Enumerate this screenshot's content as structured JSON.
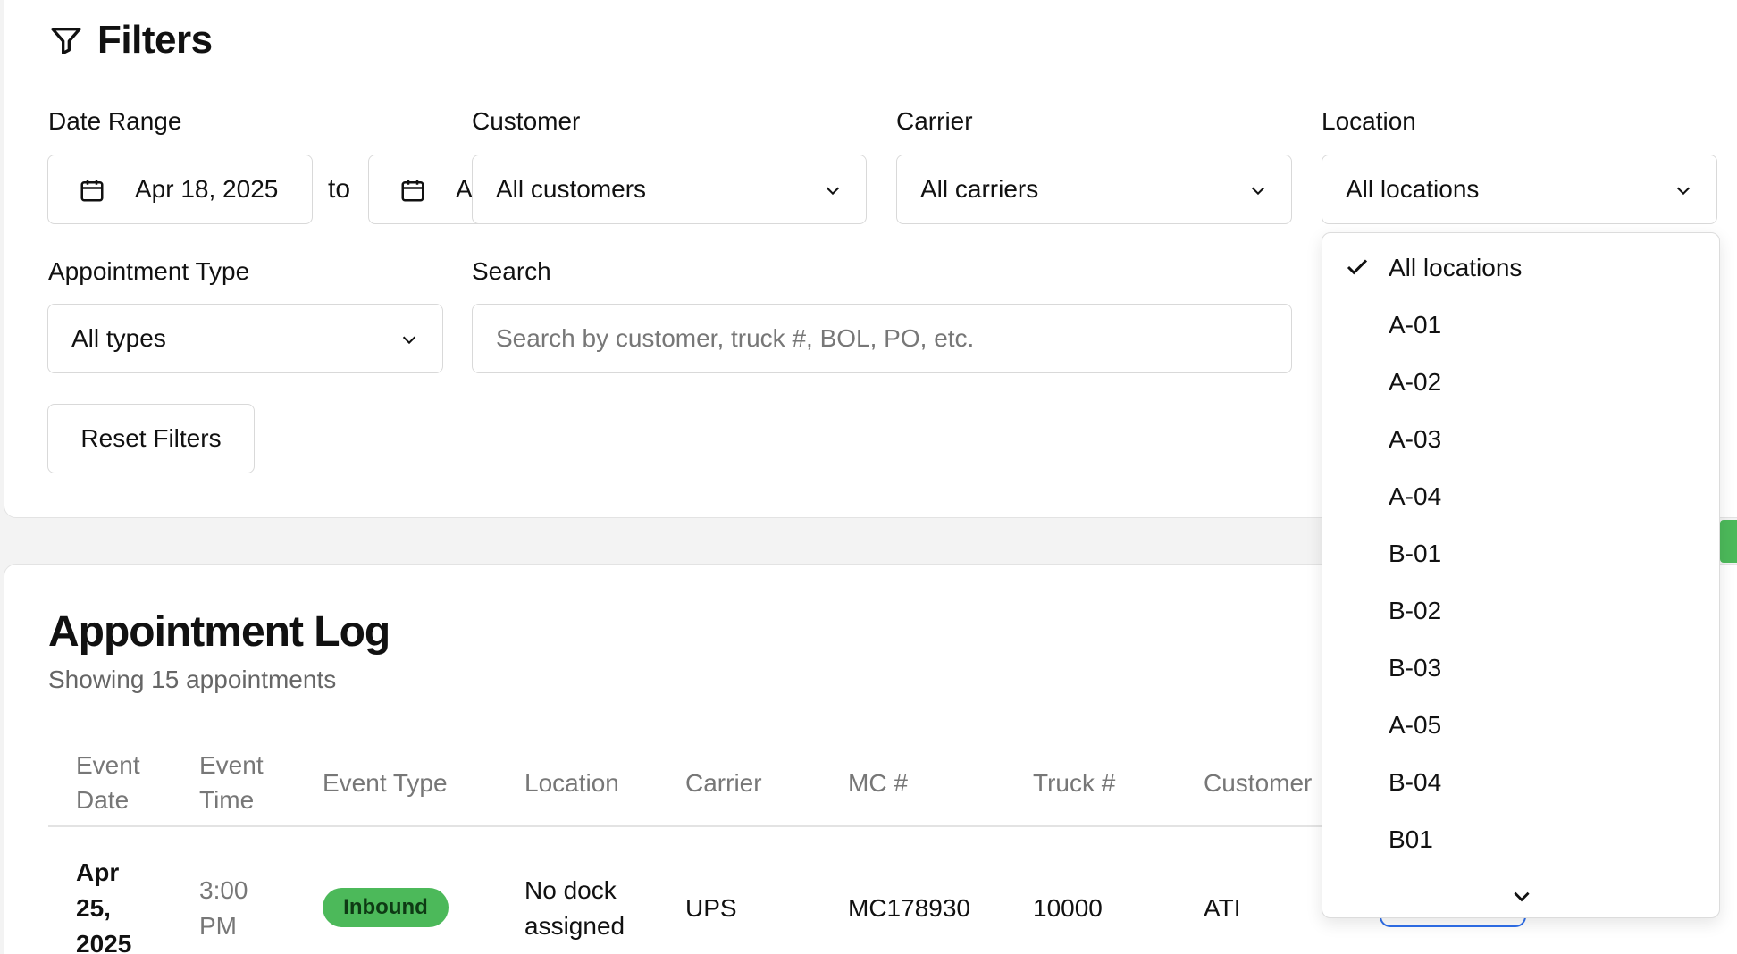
{
  "filters": {
    "title": "Filters",
    "date_range": {
      "label": "Date Range",
      "from_value": "Apr 18, 2025",
      "separator": "to",
      "to_value_visible": "A"
    },
    "customer": {
      "label": "Customer",
      "value": "All customers"
    },
    "carrier": {
      "label": "Carrier",
      "value": "All carriers"
    },
    "location": {
      "label": "Location",
      "value": "All locations"
    },
    "appointment_type": {
      "label": "Appointment Type",
      "value": "All types"
    },
    "search": {
      "label": "Search",
      "placeholder": "Search by customer, truck #, BOL, PO, etc."
    },
    "reset_label": "Reset Filters"
  },
  "location_dropdown": {
    "selected": "All locations",
    "options": [
      "All locations",
      "A-01",
      "A-02",
      "A-03",
      "A-04",
      "B-01",
      "B-02",
      "B-03",
      "A-05",
      "B-04",
      "B01"
    ]
  },
  "log": {
    "title": "Appointment Log",
    "subtitle": "Showing 15 appointments",
    "columns": [
      "Event Date",
      "Event Time",
      "Event Type",
      "Location",
      "Carrier",
      "MC #",
      "Truck #",
      "Customer"
    ],
    "rows": [
      {
        "event_date_l1": "Apr",
        "event_date_l2": "25,",
        "event_date_l3": "2025",
        "event_time_l1": "3:00",
        "event_time_l2": "PM",
        "event_type": "Inbound",
        "location_l1": "No dock",
        "location_l2": "assigned",
        "carrier": "UPS",
        "mc": "MC178930",
        "truck": "10000",
        "customer": "ATI"
      }
    ]
  },
  "colors": {
    "inbound_badge": "#4cb95a",
    "accent_blue": "#2f6fea"
  }
}
